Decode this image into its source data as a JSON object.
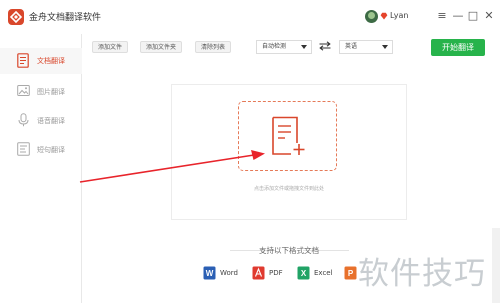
{
  "app": {
    "title": "金舟文档翻译软件",
    "accent": "#d9472b"
  },
  "user": {
    "name": "Lyan"
  },
  "window_controls": {
    "menu": "≡",
    "minimize": "—",
    "maximize": "□",
    "close": "✕"
  },
  "sidebar": {
    "items": [
      {
        "label": "文档翻译",
        "icon": "document-icon",
        "active": true
      },
      {
        "label": "图片翻译",
        "icon": "image-icon",
        "active": false
      },
      {
        "label": "语音翻译",
        "icon": "microphone-icon",
        "active": false
      },
      {
        "label": "短句翻译",
        "icon": "sentence-icon",
        "active": false
      }
    ]
  },
  "toolbar": {
    "add_file": "添加文件",
    "add_folder": "添加文件夹",
    "clear_list": "清除列表",
    "source_lang": "自动检测",
    "target_lang": "英语",
    "start": "开始翻译",
    "start_color": "#27b34b"
  },
  "drop_zone": {
    "hint": "点击添加文件或拖拽文件到此处"
  },
  "formats": {
    "title": "支持以下格式文档",
    "items": [
      {
        "label": "Word",
        "icon": "word-icon",
        "color": "#2b5fb4"
      },
      {
        "label": "PDF",
        "icon": "pdf-icon",
        "color": "#e03a2f"
      },
      {
        "label": "Excel",
        "icon": "excel-icon",
        "color": "#21a366"
      },
      {
        "label": "",
        "icon": "ppt-icon",
        "color": "#e8712c"
      }
    ]
  },
  "watermark": {
    "text": "软件技巧"
  }
}
